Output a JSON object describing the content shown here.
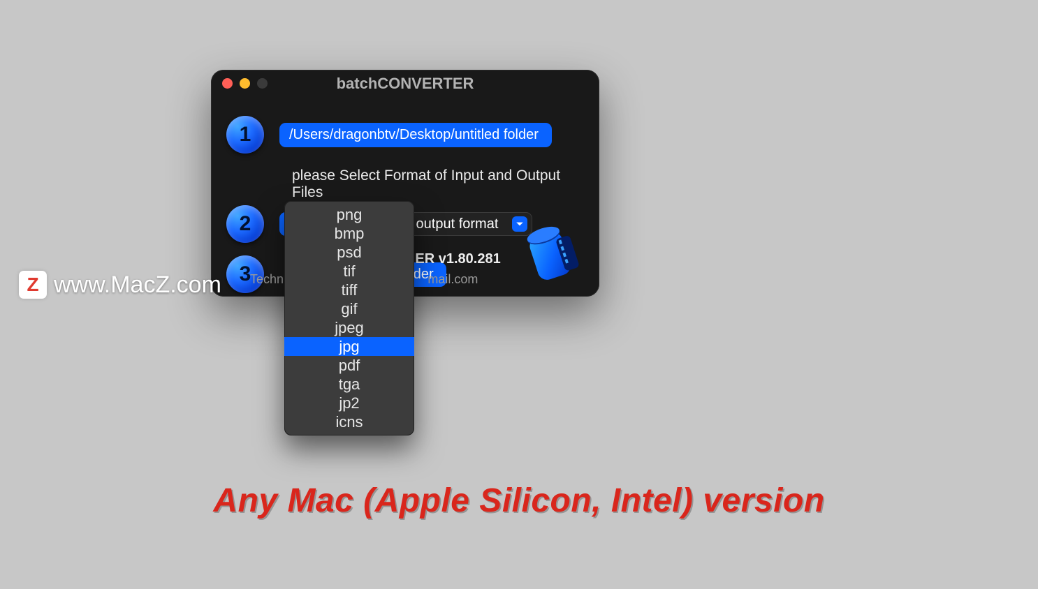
{
  "watermark": {
    "badge": "Z",
    "text": "www.MacZ.com"
  },
  "tagline": "Any Mac (Apple Silicon, Intel) version",
  "window": {
    "title": "batchCONVERTER",
    "traffic": {
      "close": "close",
      "minimize": "minimize",
      "disabled": "disabled"
    }
  },
  "step1": {
    "number": "1",
    "path": "/Users/dragonbtv/Desktop/untitled folder"
  },
  "instruction": "please Select Format of Input and Output Files",
  "step2": {
    "number": "2",
    "input_format": "jpg",
    "arrow": "→ →",
    "output_placeholder": "output format"
  },
  "step3": {
    "number": "3",
    "button_visible_part": "Folder"
  },
  "version": "ER v1.80.281",
  "support_visible_left": "Techni",
  "support_visible_right": "mail.com",
  "formats": [
    "png",
    "bmp",
    "psd",
    "tif",
    "tiff",
    "gif",
    "jpeg",
    "jpg",
    "pdf",
    "tga",
    "jp2",
    "icns"
  ],
  "selected_format": "jpg"
}
